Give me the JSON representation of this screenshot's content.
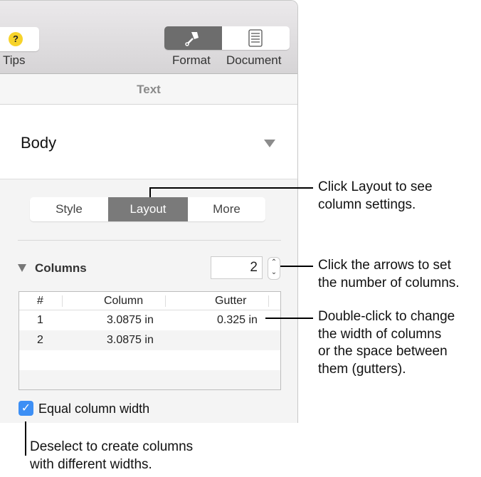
{
  "toolbar": {
    "tips_label": "Tips",
    "format_label": "Format",
    "document_label": "Document"
  },
  "panel": {
    "header": "Text",
    "paragraph_style": "Body",
    "tabs": [
      {
        "label": "Style"
      },
      {
        "label": "Layout",
        "selected": true
      },
      {
        "label": "More"
      }
    ],
    "columns": {
      "title": "Columns",
      "count": "2",
      "headers": [
        "#",
        "Column",
        "Gutter"
      ],
      "rows": [
        {
          "num": "1",
          "column": "3.0875 in",
          "gutter": "0.325 in"
        },
        {
          "num": "2",
          "column": "3.0875 in",
          "gutter": ""
        }
      ]
    },
    "equal_width": {
      "label": "Equal column width",
      "checked": true
    }
  },
  "callouts": {
    "layout": [
      "Click Layout to see",
      "column settings."
    ],
    "arrows": [
      "Click the arrows to set",
      "the number of columns."
    ],
    "width": [
      "Double-click to change",
      "the width of columns",
      "or the space between",
      "them (gutters)."
    ],
    "deselect": [
      "Deselect to create columns",
      "with different widths."
    ]
  },
  "colors": {
    "accent": "#3d8ff5",
    "selected_tab": "#7a7a7a",
    "tips_icon": "#f7d32a"
  }
}
